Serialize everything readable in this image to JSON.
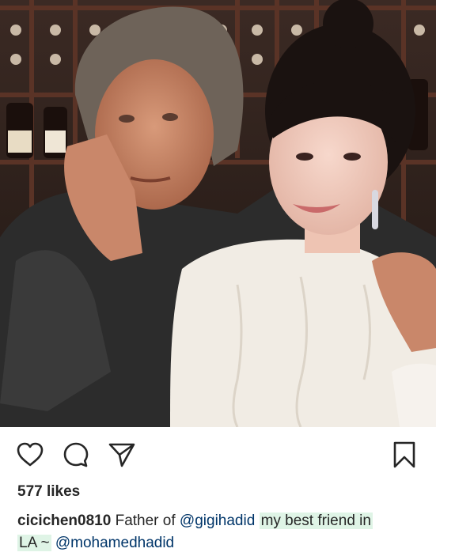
{
  "post": {
    "likes_text": "577 likes",
    "caption": {
      "username": "cicichen0810",
      "text_before": "Father of",
      "mention_1": "@gigihadid",
      "highlight_text": "my best friend in",
      "line2_start": "LA ~",
      "mention_2": "@mohamedhadid"
    }
  },
  "icons": {
    "like": "heart-icon",
    "comment": "comment-icon",
    "share": "send-icon",
    "save": "bookmark-icon"
  },
  "colors": {
    "text": "#262626",
    "highlight": "#dff4e6",
    "background": "#ffffff"
  }
}
